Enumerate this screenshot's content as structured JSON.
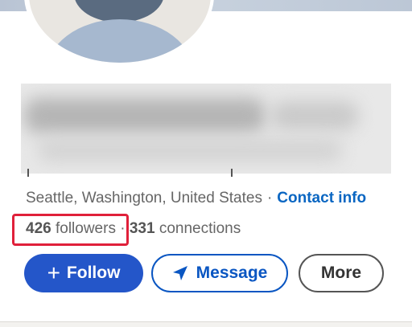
{
  "profile": {
    "location": "Seattle, Washington, United States",
    "separator": "·",
    "contact_info_label": "Contact info",
    "followers_count": "426",
    "followers_label": "followers",
    "connections_count": "331",
    "connections_label": "connections",
    "name_obscured": true,
    "avatar_icon": "default-person-avatar"
  },
  "actions": {
    "follow_icon": "plus-icon",
    "follow_label": "Follow",
    "message_icon": "paper-plane-icon",
    "message_label": "Message",
    "more_label": "More"
  },
  "highlight": {
    "target": "followers",
    "color": "#e0203a"
  },
  "colors": {
    "primary": "#2456c9",
    "link": "#0a66c2",
    "muted_text": "#666666",
    "page_background": "#f3f2ef"
  }
}
